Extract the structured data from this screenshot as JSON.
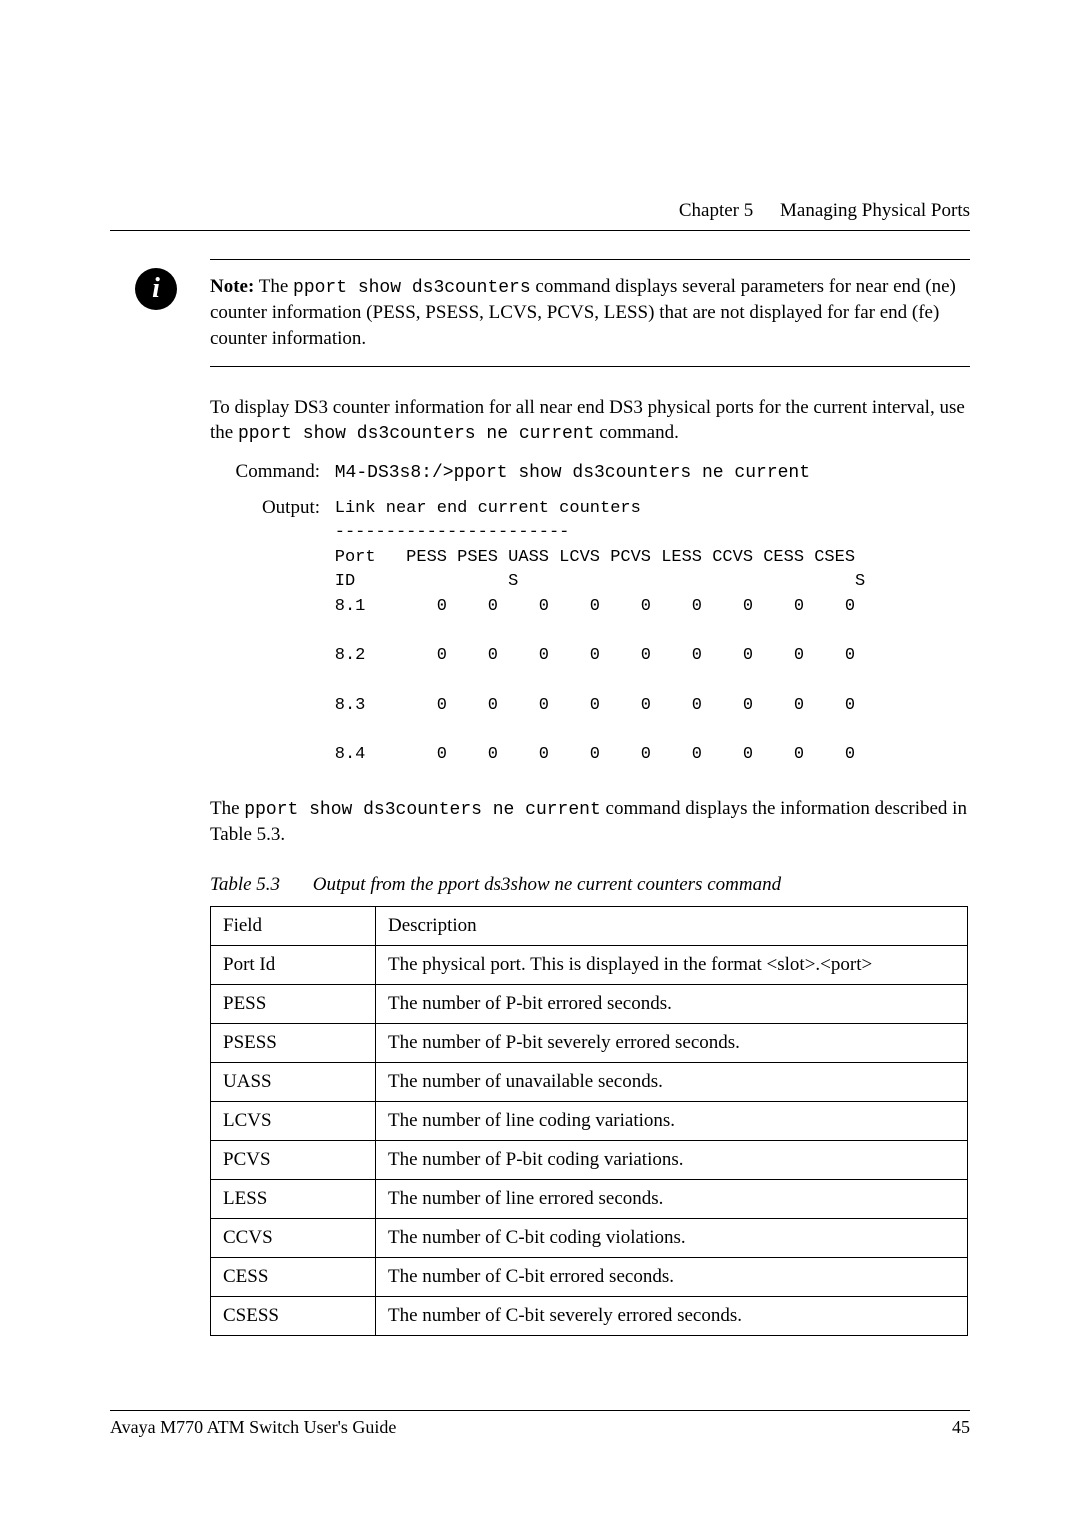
{
  "header": {
    "chapter": "Chapter 5",
    "title": "Managing Physical Ports"
  },
  "note": {
    "prefix": "Note:",
    "t1": " The ",
    "cmd": "pport show ds3counters",
    "t2": " command displays several parameters for near end (ne) counter information (PESS, PSESS, LCVS, PCVS, LESS) that are not displayed for far end (fe) counter information."
  },
  "para1": {
    "t1": "To display DS3 counter information for all near end DS3 physical ports for the current interval, use the ",
    "cmd": "pport show ds3counters ne current",
    "t2": " command."
  },
  "cmd": {
    "label": "Command:",
    "text": "M4-DS3s8:/>pport show ds3counters ne current"
  },
  "out": {
    "label": "Output:",
    "text": "Link near end current counters\n-----------------------\nPort   PESS PSES UASS LCVS PCVS LESS CCVS CESS CSES\nID               S                                 S\n8.1       0    0    0    0    0    0    0    0    0\n\n8.2       0    0    0    0    0    0    0    0    0\n\n8.3       0    0    0    0    0    0    0    0    0\n\n8.4       0    0    0    0    0    0    0    0    0"
  },
  "para2": {
    "t1": "The ",
    "cmd": "pport show ds3counters ne current",
    "t2": " command displays the information described in Table 5.3."
  },
  "tablecap": {
    "num": "Table 5.3",
    "title": "Output from the pport ds3show ne current counters command"
  },
  "thead": {
    "c1": "Field",
    "c2": "Description"
  },
  "rows": [
    {
      "f": "Port Id",
      "d": "The physical port. This is displayed in the format <slot>.<port>"
    },
    {
      "f": "PESS",
      "d": "The number of P-bit errored seconds."
    },
    {
      "f": "PSESS",
      "d": "The number of P-bit severely errored seconds."
    },
    {
      "f": "UASS",
      "d": "The number of unavailable seconds."
    },
    {
      "f": "LCVS",
      "d": "The number of line coding variations."
    },
    {
      "f": "PCVS",
      "d": "The number of P-bit coding variations."
    },
    {
      "f": "LESS",
      "d": "The number of line errored seconds."
    },
    {
      "f": "CCVS",
      "d": "The number of C-bit coding violations."
    },
    {
      "f": "CESS",
      "d": "The number of C-bit errored seconds."
    },
    {
      "f": "CSESS",
      "d": "The number of C-bit severely errored seconds."
    }
  ],
  "footer": {
    "left": "Avaya M770 ATM Switch User's Guide",
    "page": "45"
  }
}
